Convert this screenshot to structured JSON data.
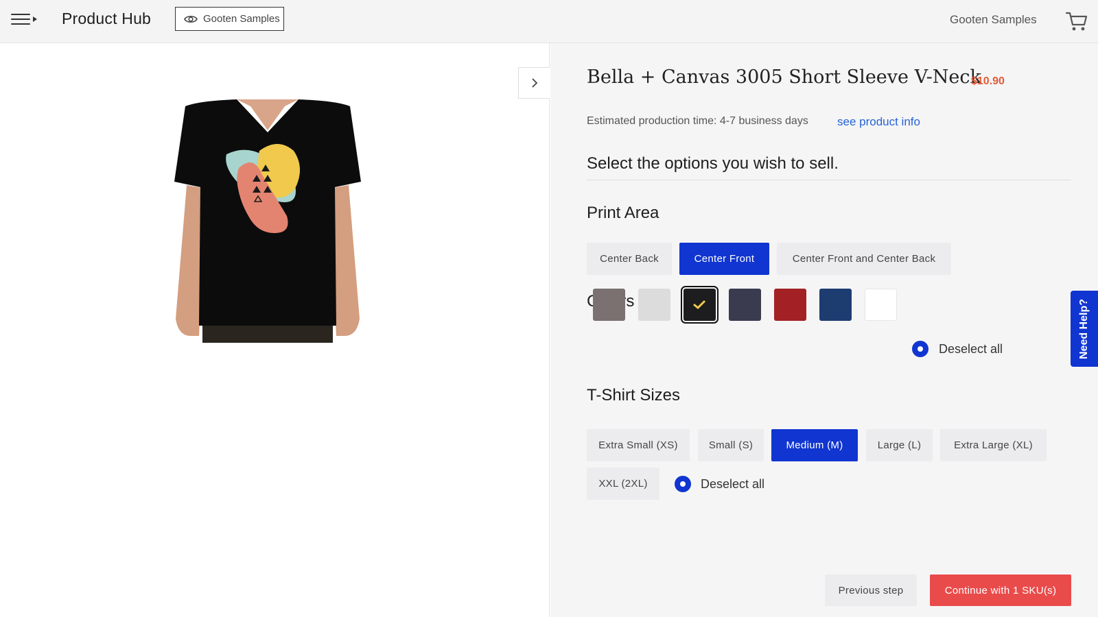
{
  "header": {
    "menu_icon": "hamburger-menu-icon",
    "app_title": "Product Hub",
    "store_button_label": "Gooten Samples",
    "store_button_icon": "eye-icon",
    "store_name": "Gooten Samples",
    "cart_icon": "cart-icon"
  },
  "preview": {
    "collapse_icon": "chevron-right-icon",
    "image_description_icon": "tshirt-image"
  },
  "product": {
    "title": "Bella + Canvas 3005 Short Sleeve V-Neck",
    "price": "$10.90",
    "estimated_production": "Estimated production time: 4-7 business days",
    "info_link": "see product info",
    "instruction": "Select the options you wish to sell."
  },
  "print_area": {
    "heading": "Print Area",
    "options": [
      {
        "label": "Center Back",
        "selected": false
      },
      {
        "label": "Center Front",
        "selected": true
      },
      {
        "label": "Center Front and Center Back",
        "selected": false
      }
    ]
  },
  "colors": {
    "heading": "Colors",
    "swatches": [
      {
        "color": "#7a7170",
        "selected": false
      },
      {
        "color": "#dcdcdc",
        "selected": false
      },
      {
        "color": "#1d1d1f",
        "selected": true
      },
      {
        "color": "#3a3b4f",
        "selected": false
      },
      {
        "color": "#a32124",
        "selected": false
      },
      {
        "color": "#1d3c70",
        "selected": false
      },
      {
        "color": "#ffffff",
        "selected": false
      }
    ],
    "deselect_label": "Deselect all"
  },
  "sizes": {
    "heading": "T-Shirt Sizes",
    "options": [
      {
        "label": "Extra Small (XS)",
        "selected": false
      },
      {
        "label": "Small (S)",
        "selected": false
      },
      {
        "label": "Medium (M)",
        "selected": true
      },
      {
        "label": "Large (L)",
        "selected": false
      },
      {
        "label": "Extra Large (XL)",
        "selected": false
      },
      {
        "label": "XXL (2XL)",
        "selected": false
      }
    ],
    "deselect_label": "Deselect all"
  },
  "help": {
    "label": "Need Help?"
  },
  "footer": {
    "previous_label": "Previous step",
    "continue_label": "Continue with 1 SKU(s)"
  },
  "theme": {
    "accent": "#1035d0",
    "price_color": "#e55a35",
    "cta_color": "#e94b4b"
  }
}
